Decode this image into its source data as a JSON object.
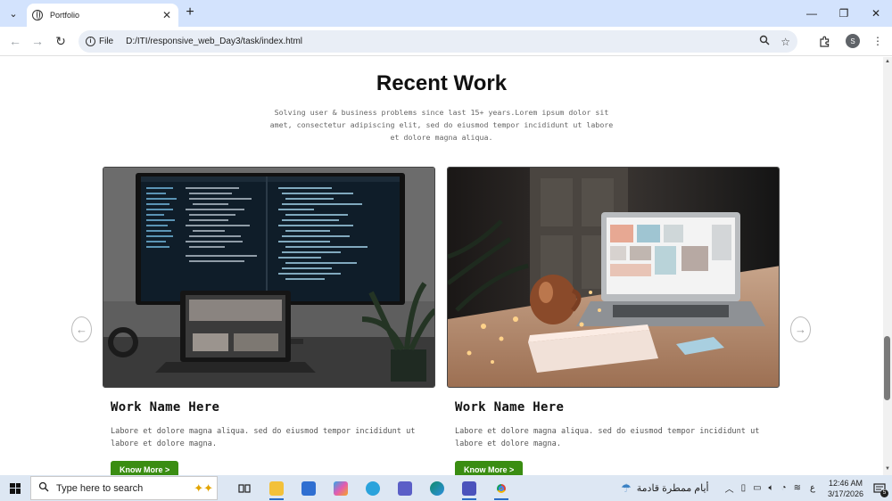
{
  "browser": {
    "tab_title": "Portfolio",
    "url_chip": "File",
    "url": "D:/ITI/responsive_web_Day3/task/index.html",
    "avatar_letter": "S"
  },
  "page": {
    "section_title": "Recent Work",
    "section_desc": "Solving user & business problems since last 15+ years.Lorem ipsum dolor sit amet, consectetur adipiscing elit, sed do eiusmod tempor incididunt ut labore et dolore magna aliqua.",
    "cards": [
      {
        "title": "Work Name Here",
        "desc": "Labore et dolore magna aliqua. sed do eiusmod tempor incididunt ut labore et dolore magna.",
        "button": "Know More >"
      },
      {
        "title": "Work Name Here",
        "desc": "Labore et dolore magna aliqua. sed do eiusmod tempor incididunt ut labore et dolore magna.",
        "button": "Know More >"
      }
    ],
    "accent_color": "#3a8d12"
  },
  "taskbar": {
    "search_placeholder": "Type here to search",
    "weather_text": "أيام ممطرة قادمة",
    "language": "ع",
    "time": "12:46 AM",
    "date": "3/17/2026",
    "notification_count": "5"
  }
}
